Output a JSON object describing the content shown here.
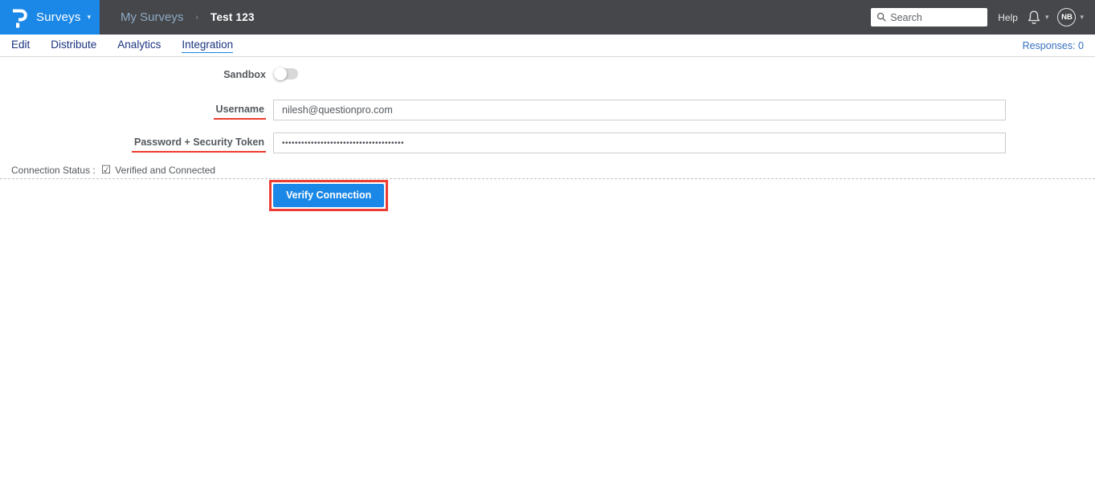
{
  "colors": {
    "brand_blue": "#1B87E6",
    "header_dark": "#45474A",
    "tab_text": "#1B3380",
    "annotation_red": "#ED3C32"
  },
  "header": {
    "logo_icon": "questionpro-logo",
    "product_label": "Surveys",
    "breadcrumb": {
      "parent": "My Surveys",
      "separator": "›",
      "current": "Test 123"
    },
    "search": {
      "placeholder": "Search",
      "value": ""
    },
    "help_label": "Help",
    "avatar_initials": "NB"
  },
  "tabs": {
    "items": [
      {
        "label": "Edit",
        "active": false
      },
      {
        "label": "Distribute",
        "active": false
      },
      {
        "label": "Analytics",
        "active": false
      },
      {
        "label": "Integration",
        "active": true
      }
    ],
    "responses_label": "Responses: 0"
  },
  "form": {
    "sandbox": {
      "label": "Sandbox",
      "enabled": false
    },
    "username": {
      "label": "Username",
      "value": "nilesh@questionpro.com"
    },
    "password": {
      "label": "Password + Security Token",
      "value": "••••••••••••••••••••••••••••••••••••••"
    },
    "connection_status": {
      "label": "Connection Status :",
      "check_glyph": "☑",
      "value": "Verified and Connected"
    },
    "verify_button_label": "Verify Connection"
  }
}
